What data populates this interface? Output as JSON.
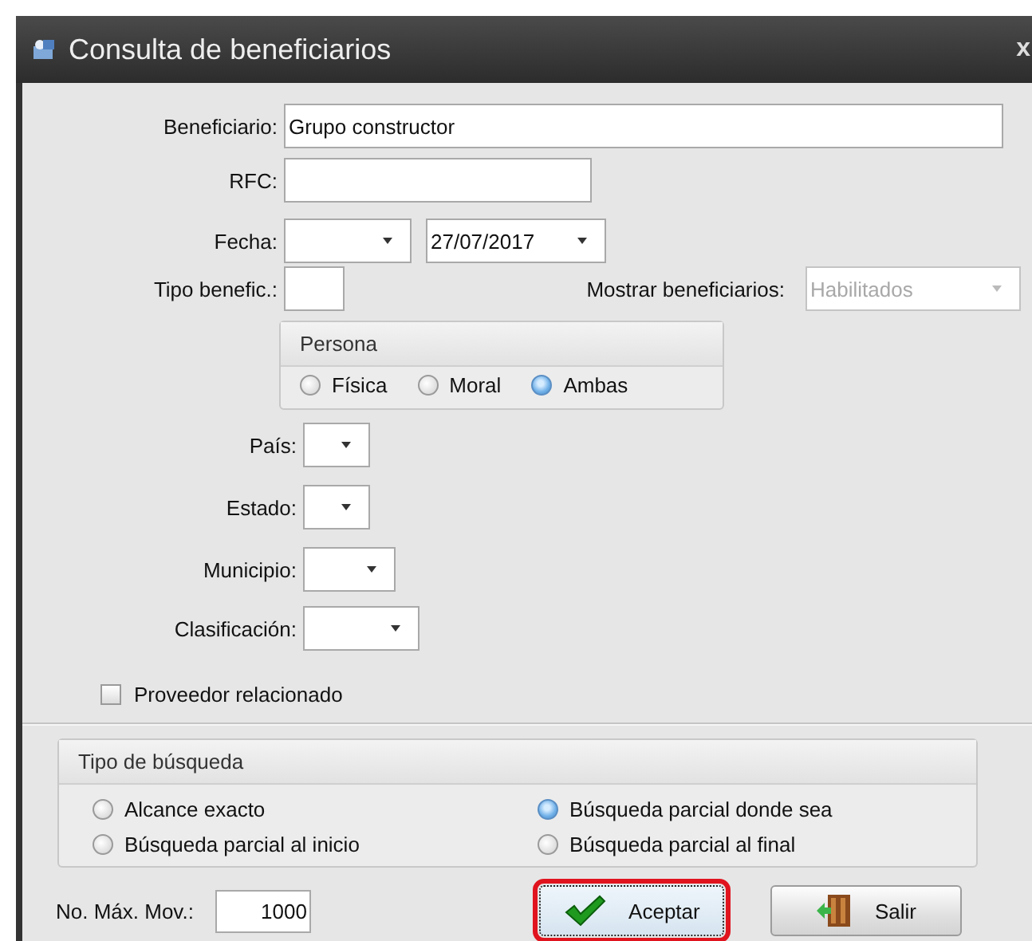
{
  "window": {
    "title": "Consulta de beneficiarios",
    "close": "x"
  },
  "beneficiario": {
    "label": "Beneficiario:",
    "value": "Grupo constructor"
  },
  "rfc": {
    "label": "RFC:"
  },
  "fecha": {
    "label": "Fecha:",
    "to_value": "27/07/2017"
  },
  "tipo_benefic": {
    "label": "Tipo benefic.:"
  },
  "mostrar": {
    "label": "Mostrar beneficiarios:",
    "value": "Habilitados",
    "disabled": true
  },
  "persona": {
    "title": "Persona",
    "options": [
      {
        "label": "Física",
        "selected": false
      },
      {
        "label": "Moral",
        "selected": false
      },
      {
        "label": "Ambas",
        "selected": true
      }
    ]
  },
  "location_fields": [
    {
      "label": "País:"
    },
    {
      "label": "Estado:"
    },
    {
      "label": "Municipio:"
    },
    {
      "label": "Clasificación:"
    }
  ],
  "proveedor": {
    "label": "Proveedor relacionado",
    "checked": false
  },
  "tipo_busqueda": {
    "title": "Tipo de búsqueda",
    "options": [
      {
        "label": "Alcance exacto",
        "selected": false
      },
      {
        "label": "Búsqueda parcial donde sea",
        "selected": true
      },
      {
        "label": "Búsqueda parcial al inicio",
        "selected": false
      },
      {
        "label": "Búsqueda parcial al final",
        "selected": false
      }
    ]
  },
  "max_mov": {
    "label": "No. Máx. Mov.:",
    "value": "1000"
  },
  "buttons": [
    {
      "kind": "accept",
      "label": "Aceptar",
      "highlighted": true
    },
    {
      "kind": "exit",
      "label": "Salir",
      "highlighted": false
    }
  ]
}
